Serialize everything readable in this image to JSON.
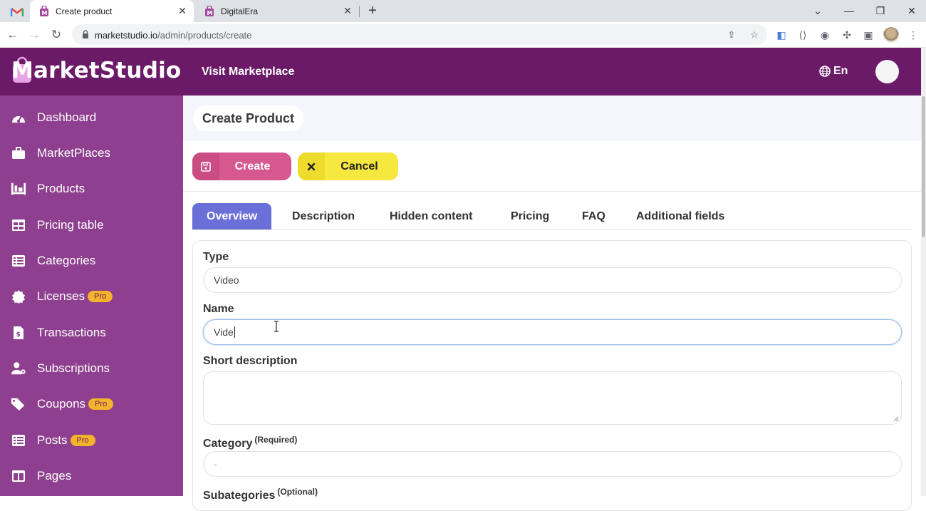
{
  "browser": {
    "tabs": [
      {
        "title": "Create product",
        "active": true
      },
      {
        "title": "DigitalEra",
        "active": false
      }
    ],
    "url_host": "marketstudio.io",
    "url_path": "/admin/products/create"
  },
  "brand": {
    "name": "MarketStudio"
  },
  "sidebar": {
    "items": [
      {
        "label": "Dashboard",
        "icon": "gauge-icon",
        "pro": ""
      },
      {
        "label": "MarketPlaces",
        "icon": "briefcase-icon",
        "pro": ""
      },
      {
        "label": "Products",
        "icon": "shelves-icon",
        "pro": ""
      },
      {
        "label": "Pricing table",
        "icon": "table-icon",
        "pro": ""
      },
      {
        "label": "Categories",
        "icon": "list-icon",
        "pro": ""
      },
      {
        "label": "Licenses",
        "icon": "certificate-icon",
        "pro": "Pro"
      },
      {
        "label": "Transactions",
        "icon": "invoice-dollar-icon",
        "pro": ""
      },
      {
        "label": "Subscriptions",
        "icon": "user-gear-icon",
        "pro": ""
      },
      {
        "label": "Coupons",
        "icon": "tags-icon",
        "pro": "Pro"
      },
      {
        "label": "Posts",
        "icon": "list-alt-icon",
        "pro": "Pro"
      },
      {
        "label": "Pages",
        "icon": "columns-icon",
        "pro": ""
      }
    ]
  },
  "header": {
    "visit_label": "Visit Marketplace",
    "lang": "En"
  },
  "page": {
    "title": "Create Product",
    "create_label": "Create",
    "cancel_label": "Cancel",
    "tabs": [
      "Overview",
      "Description",
      "Hidden content",
      "Pricing",
      "FAQ",
      "Additional fields"
    ]
  },
  "form": {
    "type_label": "Type",
    "type_value": "Video",
    "name_label": "Name",
    "name_value": "Vide",
    "short_desc_label": "Short description",
    "category_label": "Category",
    "category_note": "(Required)",
    "category_value": "-",
    "subcategories_label": "Subategories",
    "subcategories_note": "(Optional)"
  },
  "colors": {
    "brand_dark": "#6b1a68",
    "sidebar": "#8e3f8f",
    "tab_active": "#6a70d8",
    "create_button": "#d6588f",
    "cancel_button": "#f6e83f",
    "pro_badge": "#f3b32a"
  }
}
